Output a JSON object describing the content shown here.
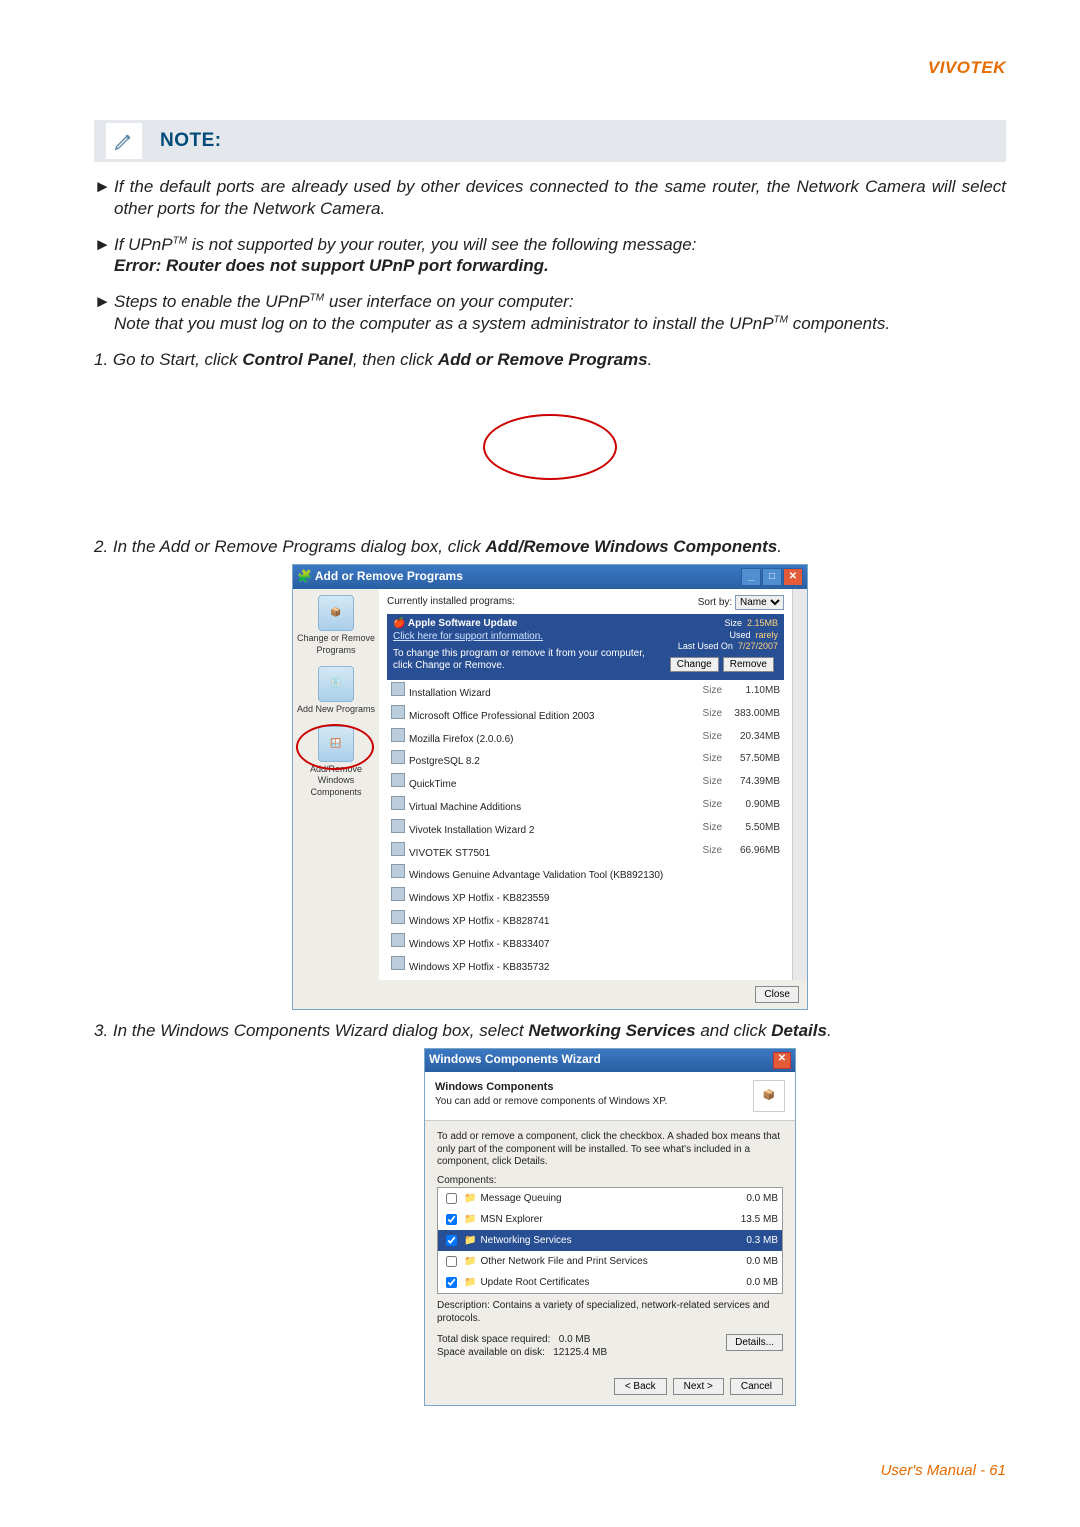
{
  "brand": "VIVOTEK",
  "note_label": "NOTE:",
  "bullets": {
    "b1": "If the default ports are already used by other devices connected to the same router, the Network Camera will select other ports for the Network Camera.",
    "b2_prefix": "If UPnP",
    "b2_tm": "TM",
    "b2_rest": " is not supported by your router, you will see the following message:",
    "b2_err": "Error: Router does not support UPnP port forwarding.",
    "b3_prefix": "Steps to enable the UPnP",
    "b3_tm": "TM",
    "b3_rest": " user interface on your computer:",
    "b3_line2a": "Note that you must log on to the computer as a system administrator to install the UPnP",
    "b3_line2_tm": "TM",
    "b3_line2b": " components."
  },
  "steps": {
    "s1a": "1. Go to Start, click ",
    "s1b": "Control Panel",
    "s1c": ", then click ",
    "s1d": "Add or Remove Programs",
    "s1e": ".",
    "s2a": "2. In the Add or Remove Programs dialog box, click ",
    "s2b": "Add/Remove Windows Components",
    "s2c": ".",
    "s3a": "3. In the Windows Components Wizard dialog box, select ",
    "s3b": "Networking Services",
    "s3c": " and click ",
    "s3d": "Details",
    "s3e": "."
  },
  "screenshot1": {
    "title": "Add or Remove Programs",
    "currently": "Currently installed programs:",
    "sortby": "Sort by:",
    "sortval": "Name",
    "side": {
      "change": "Change or Remove Programs",
      "addnew": "Add New Programs",
      "addremove": "Add/Remove Windows Components"
    },
    "highlight": {
      "name": "Apple Software Update",
      "link": "Click here for support information.",
      "changetext": "To change this program or remove it from your computer, click Change or Remove.",
      "size_lbl": "Size",
      "size": "2.15MB",
      "used_lbl": "Used",
      "used": "rarely",
      "last_lbl": "Last Used On",
      "last": "7/27/2007",
      "btn_change": "Change",
      "btn_remove": "Remove"
    },
    "rows": [
      {
        "name": "Installation Wizard",
        "size": "1.10MB"
      },
      {
        "name": "Microsoft Office Professional Edition 2003",
        "size": "383.00MB"
      },
      {
        "name": "Mozilla Firefox (2.0.0.6)",
        "size": "20.34MB"
      },
      {
        "name": "PostgreSQL 8.2",
        "size": "57.50MB"
      },
      {
        "name": "QuickTime",
        "size": "74.39MB"
      },
      {
        "name": "Virtual Machine Additions",
        "size": "0.90MB"
      },
      {
        "name": "Vivotek Installation Wizard 2",
        "size": "5.50MB"
      },
      {
        "name": "VIVOTEK ST7501",
        "size": "66.96MB"
      },
      {
        "name": "Windows Genuine Advantage Validation Tool (KB892130)",
        "size": ""
      },
      {
        "name": "Windows XP Hotfix - KB823559",
        "size": ""
      },
      {
        "name": "Windows XP Hotfix - KB828741",
        "size": ""
      },
      {
        "name": "Windows XP Hotfix - KB833407",
        "size": ""
      },
      {
        "name": "Windows XP Hotfix - KB835732",
        "size": ""
      }
    ],
    "size_lbl": "Size",
    "close": "Close"
  },
  "screenshot2": {
    "title": "Windows Components Wizard",
    "head1": "Windows Components",
    "head2": "You can add or remove components of Windows XP.",
    "desc": "To add or remove a component, click the checkbox. A shaded box means that only part of the component will be installed. To see what's included in a component, click Details.",
    "components_lbl": "Components:",
    "items": [
      {
        "checked": false,
        "name": "Message Queuing",
        "size": "0.0 MB"
      },
      {
        "checked": true,
        "name": "MSN Explorer",
        "size": "13.5 MB"
      },
      {
        "checked": true,
        "name": "Networking Services",
        "size": "0.3 MB",
        "sel": true
      },
      {
        "checked": false,
        "name": "Other Network File and Print Services",
        "size": "0.0 MB"
      },
      {
        "checked": true,
        "name": "Update Root Certificates",
        "size": "0.0 MB"
      }
    ],
    "descline": "Description:   Contains a variety of specialized, network-related services and protocols.",
    "disk_req_lbl": "Total disk space required:",
    "disk_req": "0.0 MB",
    "disk_avail_lbl": "Space available on disk:",
    "disk_avail": "12125.4 MB",
    "details": "Details...",
    "back": "< Back",
    "next": "Next >",
    "cancel": "Cancel"
  },
  "footer": "User's Manual - 61"
}
